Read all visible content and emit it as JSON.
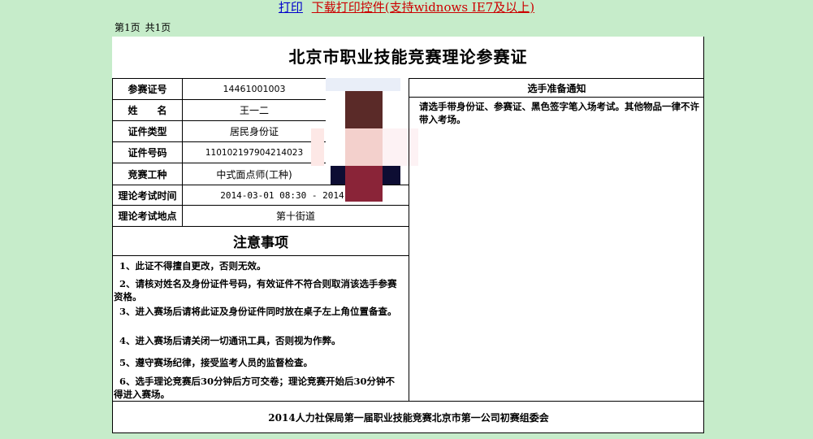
{
  "toolbar": {
    "print_link": "打印",
    "download_link": "下载打印控件(支持widnows IE7及以上)"
  },
  "page_info": {
    "current": "第1页",
    "total": "共1页"
  },
  "certificate": {
    "title": "北京市职业技能竞赛理论参赛证",
    "fields": [
      {
        "label": "参赛证号",
        "value": "14461001003"
      },
      {
        "label": "姓　　名",
        "value": "王一二"
      },
      {
        "label": "证件类型",
        "value": "居民身份证"
      },
      {
        "label": "证件号码",
        "value": "110102197904214023"
      },
      {
        "label": "竞赛工种",
        "value": "中式面点师(工种)"
      },
      {
        "label": "理论考试时间",
        "value": "2014-03-01 08:30 - 2014-03-0"
      },
      {
        "label": "理论考试地点",
        "value": "第十街道"
      }
    ],
    "notice_title": "注意事项",
    "rules": [
      "1、此证不得擅自更改，否则无效。",
      "2、请核对姓名及身份证件号码，有效证件不符合则取消该选手参赛资格。",
      "3、进入赛场后请将此证及身份证件同时放在桌子左上角位置备查。",
      "4、进入赛场后请关闭一切通讯工具，否则视为作弊。",
      "5、遵守赛场纪律，接受监考人员的监督检查。",
      "6、选手理论竞赛后30分钟后方可交卷；理论竞赛开始后30分钟不得进入赛场。"
    ],
    "right_header": "选手准备通知",
    "right_text": "请选手带身份证、参赛证、黑色签字笔入场考试。其他物品一律不许带入考场。",
    "footer": "2014人力社保局第一届职业技能竞赛北京市第一公司初赛组委会"
  },
  "photo_colors": [
    "#e9eef8",
    "#5a2a28",
    "#f3d0cc",
    "#8a2438",
    "#0d0d33"
  ]
}
